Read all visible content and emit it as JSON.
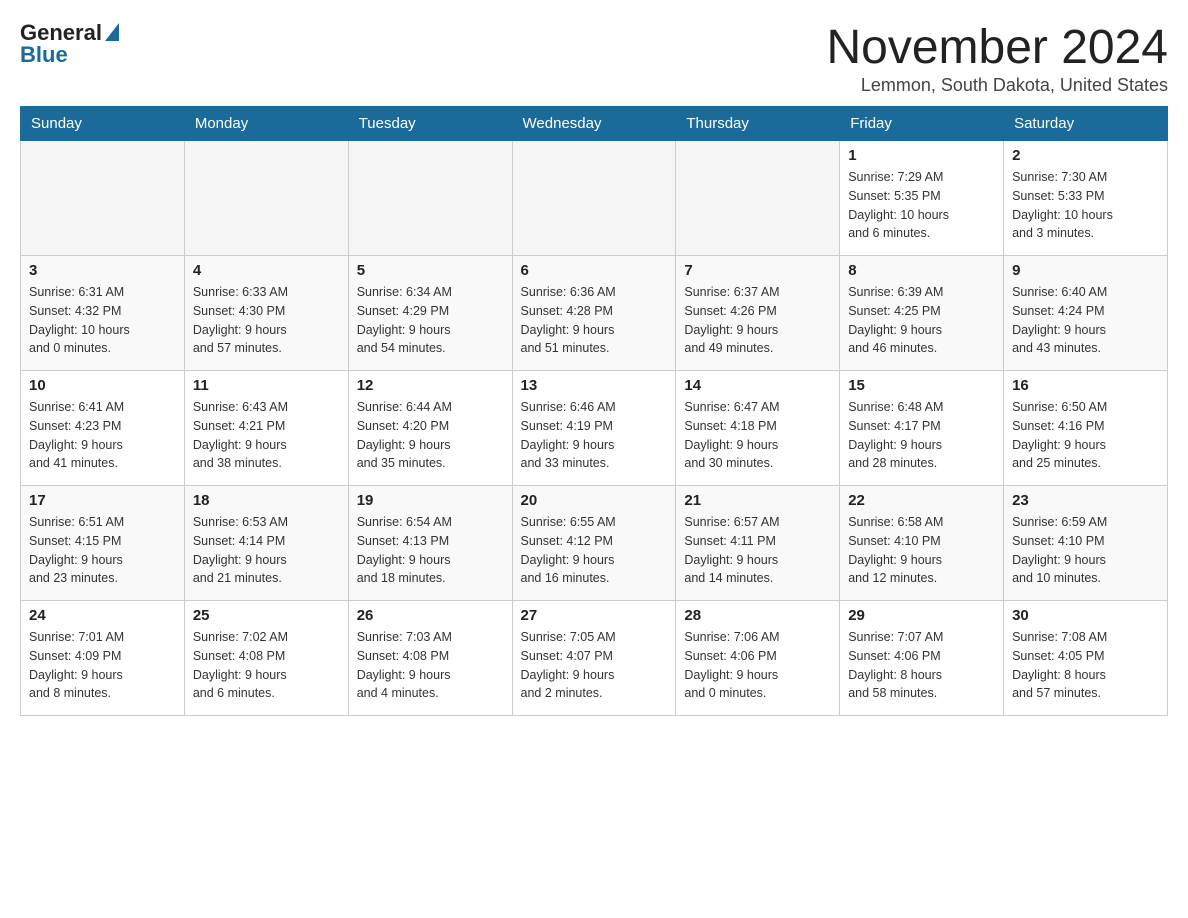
{
  "header": {
    "logo_general": "General",
    "logo_blue": "Blue",
    "month_title": "November 2024",
    "location": "Lemmon, South Dakota, United States"
  },
  "days_of_week": [
    "Sunday",
    "Monday",
    "Tuesday",
    "Wednesday",
    "Thursday",
    "Friday",
    "Saturday"
  ],
  "weeks": [
    [
      {
        "day": "",
        "info": ""
      },
      {
        "day": "",
        "info": ""
      },
      {
        "day": "",
        "info": ""
      },
      {
        "day": "",
        "info": ""
      },
      {
        "day": "",
        "info": ""
      },
      {
        "day": "1",
        "info": "Sunrise: 7:29 AM\nSunset: 5:35 PM\nDaylight: 10 hours\nand 6 minutes."
      },
      {
        "day": "2",
        "info": "Sunrise: 7:30 AM\nSunset: 5:33 PM\nDaylight: 10 hours\nand 3 minutes."
      }
    ],
    [
      {
        "day": "3",
        "info": "Sunrise: 6:31 AM\nSunset: 4:32 PM\nDaylight: 10 hours\nand 0 minutes."
      },
      {
        "day": "4",
        "info": "Sunrise: 6:33 AM\nSunset: 4:30 PM\nDaylight: 9 hours\nand 57 minutes."
      },
      {
        "day": "5",
        "info": "Sunrise: 6:34 AM\nSunset: 4:29 PM\nDaylight: 9 hours\nand 54 minutes."
      },
      {
        "day": "6",
        "info": "Sunrise: 6:36 AM\nSunset: 4:28 PM\nDaylight: 9 hours\nand 51 minutes."
      },
      {
        "day": "7",
        "info": "Sunrise: 6:37 AM\nSunset: 4:26 PM\nDaylight: 9 hours\nand 49 minutes."
      },
      {
        "day": "8",
        "info": "Sunrise: 6:39 AM\nSunset: 4:25 PM\nDaylight: 9 hours\nand 46 minutes."
      },
      {
        "day": "9",
        "info": "Sunrise: 6:40 AM\nSunset: 4:24 PM\nDaylight: 9 hours\nand 43 minutes."
      }
    ],
    [
      {
        "day": "10",
        "info": "Sunrise: 6:41 AM\nSunset: 4:23 PM\nDaylight: 9 hours\nand 41 minutes."
      },
      {
        "day": "11",
        "info": "Sunrise: 6:43 AM\nSunset: 4:21 PM\nDaylight: 9 hours\nand 38 minutes."
      },
      {
        "day": "12",
        "info": "Sunrise: 6:44 AM\nSunset: 4:20 PM\nDaylight: 9 hours\nand 35 minutes."
      },
      {
        "day": "13",
        "info": "Sunrise: 6:46 AM\nSunset: 4:19 PM\nDaylight: 9 hours\nand 33 minutes."
      },
      {
        "day": "14",
        "info": "Sunrise: 6:47 AM\nSunset: 4:18 PM\nDaylight: 9 hours\nand 30 minutes."
      },
      {
        "day": "15",
        "info": "Sunrise: 6:48 AM\nSunset: 4:17 PM\nDaylight: 9 hours\nand 28 minutes."
      },
      {
        "day": "16",
        "info": "Sunrise: 6:50 AM\nSunset: 4:16 PM\nDaylight: 9 hours\nand 25 minutes."
      }
    ],
    [
      {
        "day": "17",
        "info": "Sunrise: 6:51 AM\nSunset: 4:15 PM\nDaylight: 9 hours\nand 23 minutes."
      },
      {
        "day": "18",
        "info": "Sunrise: 6:53 AM\nSunset: 4:14 PM\nDaylight: 9 hours\nand 21 minutes."
      },
      {
        "day": "19",
        "info": "Sunrise: 6:54 AM\nSunset: 4:13 PM\nDaylight: 9 hours\nand 18 minutes."
      },
      {
        "day": "20",
        "info": "Sunrise: 6:55 AM\nSunset: 4:12 PM\nDaylight: 9 hours\nand 16 minutes."
      },
      {
        "day": "21",
        "info": "Sunrise: 6:57 AM\nSunset: 4:11 PM\nDaylight: 9 hours\nand 14 minutes."
      },
      {
        "day": "22",
        "info": "Sunrise: 6:58 AM\nSunset: 4:10 PM\nDaylight: 9 hours\nand 12 minutes."
      },
      {
        "day": "23",
        "info": "Sunrise: 6:59 AM\nSunset: 4:10 PM\nDaylight: 9 hours\nand 10 minutes."
      }
    ],
    [
      {
        "day": "24",
        "info": "Sunrise: 7:01 AM\nSunset: 4:09 PM\nDaylight: 9 hours\nand 8 minutes."
      },
      {
        "day": "25",
        "info": "Sunrise: 7:02 AM\nSunset: 4:08 PM\nDaylight: 9 hours\nand 6 minutes."
      },
      {
        "day": "26",
        "info": "Sunrise: 7:03 AM\nSunset: 4:08 PM\nDaylight: 9 hours\nand 4 minutes."
      },
      {
        "day": "27",
        "info": "Sunrise: 7:05 AM\nSunset: 4:07 PM\nDaylight: 9 hours\nand 2 minutes."
      },
      {
        "day": "28",
        "info": "Sunrise: 7:06 AM\nSunset: 4:06 PM\nDaylight: 9 hours\nand 0 minutes."
      },
      {
        "day": "29",
        "info": "Sunrise: 7:07 AM\nSunset: 4:06 PM\nDaylight: 8 hours\nand 58 minutes."
      },
      {
        "day": "30",
        "info": "Sunrise: 7:08 AM\nSunset: 4:05 PM\nDaylight: 8 hours\nand 57 minutes."
      }
    ]
  ]
}
